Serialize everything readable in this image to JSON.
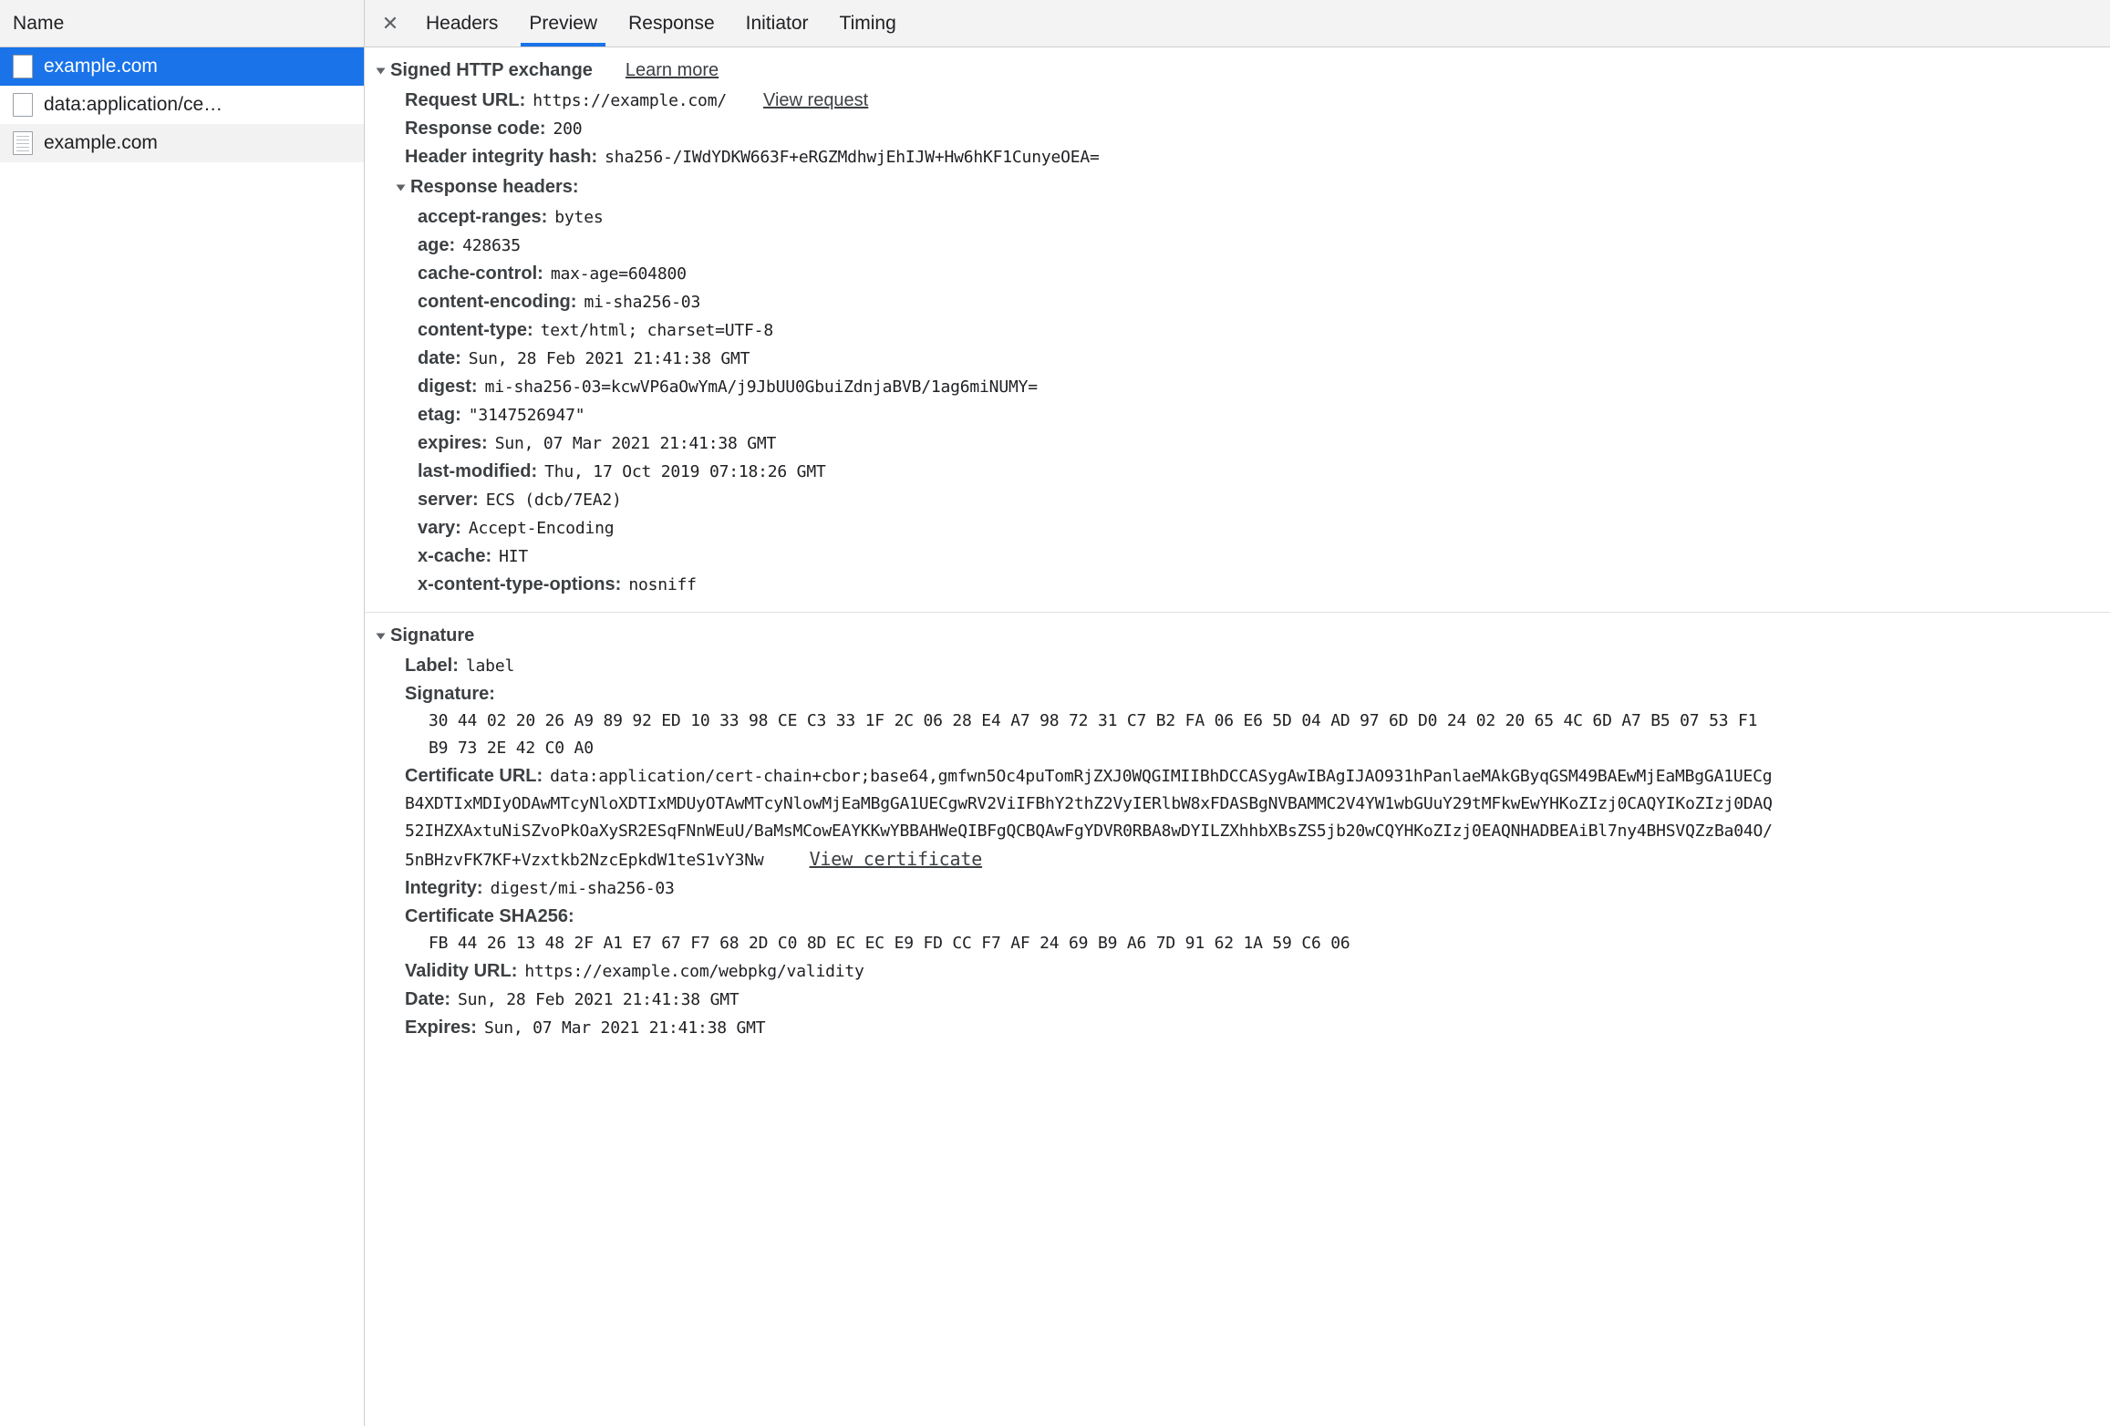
{
  "left_panel": {
    "column_header": "Name",
    "rows": [
      {
        "label": "example.com",
        "icon": "blank-document-icon",
        "selected": true
      },
      {
        "label": "data:application/ce…",
        "icon": "blank-document-icon",
        "selected": false
      },
      {
        "label": "example.com",
        "icon": "text-document-icon",
        "selected": false
      }
    ]
  },
  "tabbar": {
    "close_label": "✕",
    "tabs": [
      {
        "label": "Headers",
        "active": false
      },
      {
        "label": "Preview",
        "active": true
      },
      {
        "label": "Response",
        "active": false
      },
      {
        "label": "Initiator",
        "active": false
      },
      {
        "label": "Timing",
        "active": false
      }
    ]
  },
  "sxg": {
    "section_title": "Signed HTTP exchange",
    "learn_more": "Learn more",
    "request_url_key": "Request URL:",
    "request_url_value": "https://example.com/",
    "view_request": "View request",
    "response_code_key": "Response code:",
    "response_code_value": "200",
    "header_integrity_key": "Header integrity hash:",
    "header_integrity_value": "sha256-/IWdYDKW663F+eRGZMdhwjEhIJW+Hw6hKF1CunyeOEA=",
    "response_headers_title": "Response headers:",
    "response_headers": [
      {
        "name": "accept-ranges:",
        "value": "bytes"
      },
      {
        "name": "age:",
        "value": "428635"
      },
      {
        "name": "cache-control:",
        "value": "max-age=604800"
      },
      {
        "name": "content-encoding:",
        "value": "mi-sha256-03"
      },
      {
        "name": "content-type:",
        "value": "text/html; charset=UTF-8"
      },
      {
        "name": "date:",
        "value": "Sun, 28 Feb 2021 21:41:38 GMT"
      },
      {
        "name": "digest:",
        "value": "mi-sha256-03=kcwVP6aOwYmA/j9JbUU0GbuiZdnjaBVB/1ag6miNUMY="
      },
      {
        "name": "etag:",
        "value": "\"3147526947\""
      },
      {
        "name": "expires:",
        "value": "Sun, 07 Mar 2021 21:41:38 GMT"
      },
      {
        "name": "last-modified:",
        "value": "Thu, 17 Oct 2019 07:18:26 GMT"
      },
      {
        "name": "server:",
        "value": "ECS (dcb/7EA2)"
      },
      {
        "name": "vary:",
        "value": "Accept-Encoding"
      },
      {
        "name": "x-cache:",
        "value": "HIT"
      },
      {
        "name": "x-content-type-options:",
        "value": "nosniff"
      }
    ]
  },
  "signature": {
    "section_title": "Signature",
    "label_key": "Label:",
    "label_value": "label",
    "signature_key": "Signature:",
    "signature_bytes": [
      "30 44 02 20 26 A9 89 92 ED 10 33 98 CE C3 33 1F 2C 06 28 E4 A7 98 72 31 C7 B2 FA 06 E6 5D 04 AD 97 6D D0 24 02 20 65 4C 6D A7 B5 07 53 F1",
      "B9 73 2E 42 C0 A0"
    ],
    "certificate_url_key": "Certificate URL:",
    "certificate_url_lines": [
      "data:application/cert-chain+cbor;base64,gmfwn5Oc4puTomRjZXJ0WQGIMIIBhDCCASygAwIBAgIJAO931hPanlaeMAkGByqGSM49BAEwMjEaMBgGA1UECg",
      "B4XDTIxMDIyODAwMTcyNloXDTIxMDUyOTAwMTcyNlowMjEaMBgGA1UECgwRV2ViIFBhY2thZ2VyIERlbW8xFDASBgNVBAMMC2V4YW1wbGUuY29tMFkwEwYHKoZIzj0CAQYIKoZIzj0DAQ",
      "52IHZXAxtuNiSZvoPkOaXySR2ESqFNnWEuU/BaMsMCowEAYKKwYBBAHWeQIBFgQCBQAwFgYDVR0RBA8wDYILZXhhbXBsZS5jb20wCQYHKoZIzj0EAQNHADBEAiBl7ny4BHSVQZzBa04O/",
      "5nBHzvFK7KF+Vzxtkb2NzcEpkdW1teS1vY3Nw"
    ],
    "view_certificate": "View certificate",
    "integrity_key": "Integrity:",
    "integrity_value": "digest/mi-sha256-03",
    "cert_sha256_key": "Certificate SHA256:",
    "cert_sha256_bytes": "FB 44 26 13 48 2F A1 E7 67 F7 68 2D C0 8D EC EC E9 FD CC F7 AF 24 69 B9 A6 7D 91 62 1A 59 C6 06",
    "validity_url_key": "Validity URL:",
    "validity_url_value": "https://example.com/webpkg/validity",
    "date_key": "Date:",
    "date_value": "Sun, 28 Feb 2021 21:41:38 GMT",
    "expires_key": "Expires:",
    "expires_value": "Sun, 07 Mar 2021 21:41:38 GMT"
  },
  "colors": {
    "accent": "#1a73e8",
    "panel_bg": "#f3f3f3",
    "text": "#202124",
    "key_text": "#3c4043",
    "border": "#cdcdcd"
  }
}
